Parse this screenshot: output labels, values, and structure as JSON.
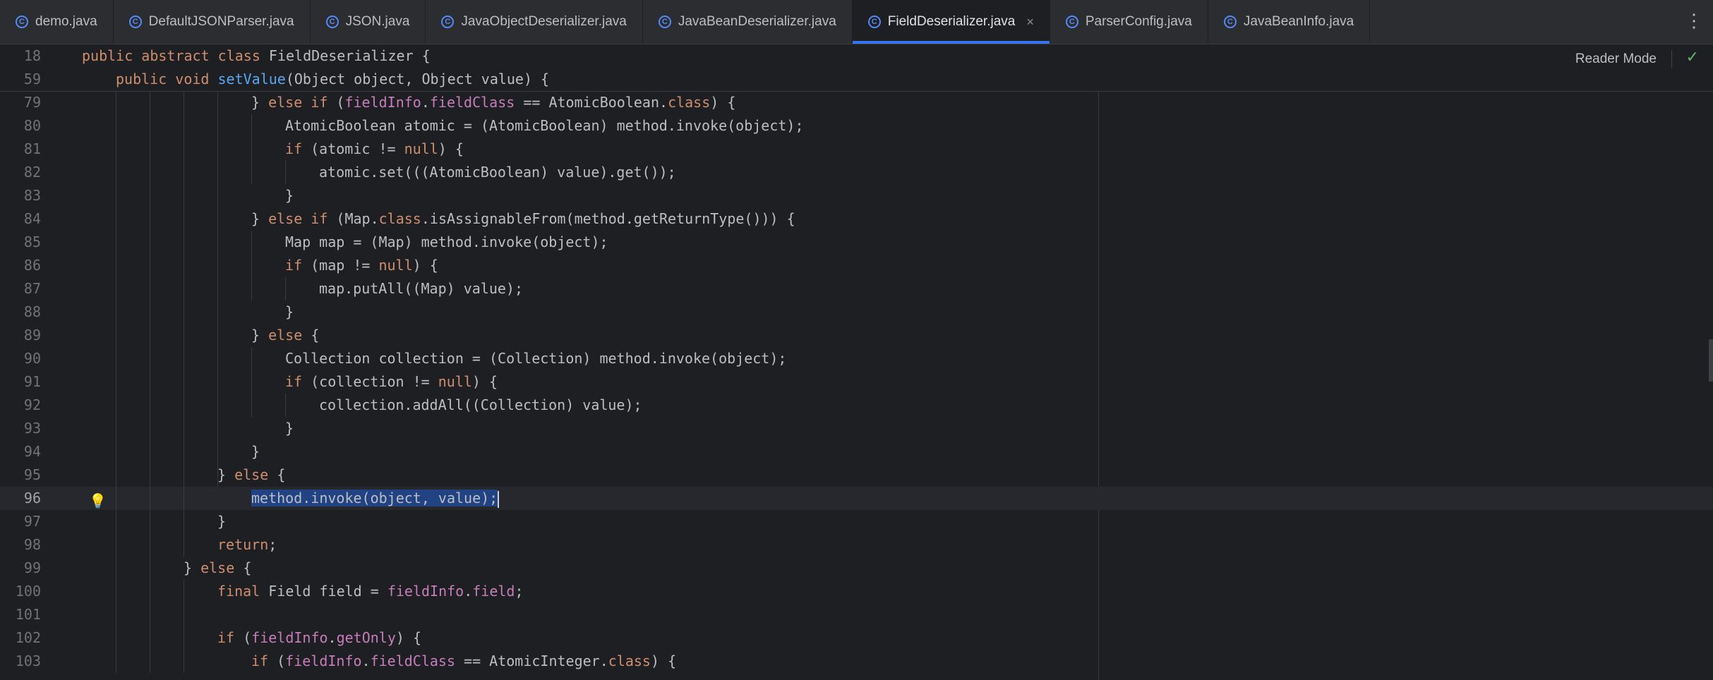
{
  "tabs": [
    {
      "label": "demo.java",
      "active": false
    },
    {
      "label": "DefaultJSONParser.java",
      "active": false
    },
    {
      "label": "JSON.java",
      "active": false
    },
    {
      "label": "JavaObjectDeserializer.java",
      "active": false
    },
    {
      "label": "JavaBeanDeserializer.java",
      "active": false
    },
    {
      "label": "FieldDeserializer.java",
      "active": true
    },
    {
      "label": "ParserConfig.java",
      "active": false
    },
    {
      "label": "JavaBeanInfo.java",
      "active": false
    }
  ],
  "tab_icon_letter": "C",
  "tab_close": "×",
  "tab_menu": "⋮",
  "reader_mode": "Reader Mode",
  "check": "✓",
  "sticky": [
    {
      "n": "18",
      "indent": 0,
      "tokens": [
        [
          "kw",
          "public abstract class "
        ],
        [
          "",
          "FieldDeserializer {"
        ]
      ]
    },
    {
      "n": "59",
      "indent": 1,
      "tokens": [
        [
          "kw",
          "public void "
        ],
        [
          "fn",
          "setValue"
        ],
        [
          "",
          "(Object object, Object value) {"
        ]
      ]
    }
  ],
  "lines": [
    {
      "n": "79",
      "indent": 5,
      "tokens": [
        [
          "",
          "} "
        ],
        [
          "kw",
          "else if "
        ],
        [
          "",
          "("
        ],
        [
          "fld",
          "fieldInfo"
        ],
        [
          "",
          "."
        ],
        [
          "fld",
          "fieldClass"
        ],
        [
          "",
          " == AtomicBoolean."
        ],
        [
          "kw",
          "class"
        ],
        [
          "",
          ") {"
        ]
      ]
    },
    {
      "n": "80",
      "indent": 6,
      "tokens": [
        [
          "",
          "AtomicBoolean atomic = (AtomicBoolean) method.invoke(object);"
        ]
      ]
    },
    {
      "n": "81",
      "indent": 6,
      "tokens": [
        [
          "kw",
          "if "
        ],
        [
          "",
          "(atomic != "
        ],
        [
          "kw",
          "null"
        ],
        [
          "",
          ") {"
        ]
      ]
    },
    {
      "n": "82",
      "indent": 7,
      "tokens": [
        [
          "",
          "atomic.set(((AtomicBoolean) value).get());"
        ]
      ]
    },
    {
      "n": "83",
      "indent": 6,
      "tokens": [
        [
          "",
          "}"
        ]
      ]
    },
    {
      "n": "84",
      "indent": 5,
      "tokens": [
        [
          "",
          "} "
        ],
        [
          "kw",
          "else if "
        ],
        [
          "",
          "(Map."
        ],
        [
          "kw",
          "class"
        ],
        [
          "",
          ".isAssignableFrom(method.getReturnType())) {"
        ]
      ]
    },
    {
      "n": "85",
      "indent": 6,
      "tokens": [
        [
          "",
          "Map map = (Map) method.invoke(object);"
        ]
      ]
    },
    {
      "n": "86",
      "indent": 6,
      "tokens": [
        [
          "kw",
          "if "
        ],
        [
          "",
          "(map != "
        ],
        [
          "kw",
          "null"
        ],
        [
          "",
          ") {"
        ]
      ]
    },
    {
      "n": "87",
      "indent": 7,
      "tokens": [
        [
          "",
          "map.putAll((Map) value);"
        ]
      ]
    },
    {
      "n": "88",
      "indent": 6,
      "tokens": [
        [
          "",
          "}"
        ]
      ]
    },
    {
      "n": "89",
      "indent": 5,
      "tokens": [
        [
          "",
          "} "
        ],
        [
          "kw",
          "else "
        ],
        [
          "",
          "{"
        ]
      ]
    },
    {
      "n": "90",
      "indent": 6,
      "tokens": [
        [
          "",
          "Collection collection = (Collection) method.invoke(object);"
        ]
      ]
    },
    {
      "n": "91",
      "indent": 6,
      "tokens": [
        [
          "kw",
          "if "
        ],
        [
          "",
          "(collection != "
        ],
        [
          "kw",
          "null"
        ],
        [
          "",
          ") {"
        ]
      ]
    },
    {
      "n": "92",
      "indent": 7,
      "tokens": [
        [
          "",
          "collection.addAll((Collection) value);"
        ]
      ]
    },
    {
      "n": "93",
      "indent": 6,
      "tokens": [
        [
          "",
          "}"
        ]
      ]
    },
    {
      "n": "94",
      "indent": 5,
      "tokens": [
        [
          "",
          "}"
        ]
      ]
    },
    {
      "n": "95",
      "indent": 4,
      "tokens": [
        [
          "",
          "} "
        ],
        [
          "kw",
          "else "
        ],
        [
          "",
          "{"
        ]
      ]
    },
    {
      "n": "96",
      "indent": 5,
      "current": true,
      "tokens": [
        [
          "sel",
          "method.invoke(object, value);"
        ]
      ]
    },
    {
      "n": "97",
      "indent": 4,
      "tokens": [
        [
          "",
          "}"
        ]
      ]
    },
    {
      "n": "98",
      "indent": 4,
      "tokens": [
        [
          "kw",
          "return"
        ],
        [
          "",
          ";"
        ]
      ]
    },
    {
      "n": "99",
      "indent": 3,
      "tokens": [
        [
          "",
          "} "
        ],
        [
          "kw",
          "else "
        ],
        [
          "",
          "{"
        ]
      ]
    },
    {
      "n": "100",
      "indent": 4,
      "tokens": [
        [
          "kw",
          "final "
        ],
        [
          "",
          "Field field = "
        ],
        [
          "fld",
          "fieldInfo"
        ],
        [
          "",
          "."
        ],
        [
          "fld",
          "field"
        ],
        [
          "",
          ";"
        ]
      ]
    },
    {
      "n": "101",
      "indent": 0,
      "tokens": []
    },
    {
      "n": "102",
      "indent": 4,
      "tokens": [
        [
          "kw",
          "if "
        ],
        [
          "",
          "("
        ],
        [
          "fld",
          "fieldInfo"
        ],
        [
          "",
          "."
        ],
        [
          "fld",
          "getOnly"
        ],
        [
          "",
          ") {"
        ]
      ]
    },
    {
      "n": "103",
      "indent": 5,
      "tokens": [
        [
          "kw",
          "if "
        ],
        [
          "",
          "("
        ],
        [
          "fld",
          "fieldInfo"
        ],
        [
          "",
          "."
        ],
        [
          "fld",
          "fieldClass"
        ],
        [
          "",
          " == AtomicInteger."
        ],
        [
          "kw",
          "class"
        ],
        [
          "",
          ") {"
        ]
      ]
    }
  ]
}
